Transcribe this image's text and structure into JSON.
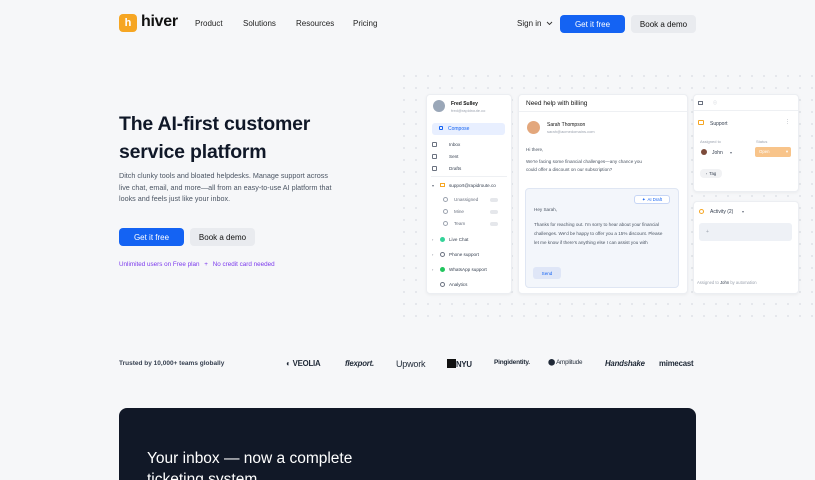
{
  "nav": {
    "logo_letter": "h",
    "brand": "hiver",
    "links": [
      "Product",
      "Solutions",
      "Resources",
      "Pricing"
    ],
    "sign_in": "Sign in",
    "get_it_free": "Get it free",
    "book_demo": "Book a demo"
  },
  "hero": {
    "title": "The AI-first customer service platform",
    "subtitle": "Ditch clunky tools and bloated helpdesks. Manage support across live chat, email, and more—all from an easy-to-use AI platform that looks and feels just like your inbox.",
    "cta_primary": "Get it free",
    "cta_secondary": "Book a demo",
    "note_a": "Unlimited users on Free plan",
    "note_sep": "+",
    "note_b": "No credit card needed"
  },
  "mockup": {
    "user_name": "Fred Sulley",
    "user_email": "fred@rapidroute.co",
    "compose": "Compose",
    "nav": [
      "Inbox",
      "Sent",
      "Drafts"
    ],
    "mailbox": "support@rapidroute.co",
    "sub_items": [
      "Unassigned",
      "Mine",
      "Team"
    ],
    "channels": [
      "Live Chat",
      "Phone support",
      "WhatsApp support",
      "Analytics"
    ],
    "thread_title": "Need help with billing",
    "sender_name": "Sarah Thompson",
    "sender_email": "sarah@acmedomains.com",
    "greeting": "Hi there,",
    "body": "We're facing some financial challenges—any chance you could offer a discount on our subscription?",
    "ai_badge": "AI Draft",
    "draft_greeting": "Hey Sarah,",
    "draft_body": "Thanks for reaching out. I'm sorry to hear about your financial challenges. We'd be happy to offer you a 15% discount. Please let me know if there's anything else I can assist you with",
    "send": "Send",
    "panel_tabs": [
      "",
      ""
    ],
    "panel_support": "Support",
    "assigned_label": "Assigned to",
    "assignee": "John",
    "status_label": "Status",
    "status_value": "Open",
    "tag": "Tag",
    "activity": "Activity (2)",
    "plus": "+",
    "assigned_prefix": "Assigned to",
    "assigned_who": "John",
    "assigned_by": "by automation"
  },
  "trusted": {
    "label": "Trusted by 10,000+ teams globally",
    "brands": [
      "VEOLIA",
      "flexport.",
      "Upwork",
      "NYU",
      "Pingidentity.",
      "Amplitude",
      "Handshake",
      "mimecast"
    ]
  },
  "section": {
    "title": "Your inbox — now a complete ticketing system"
  },
  "colors": {
    "primary": "#1463f3",
    "logo": "#f6a623",
    "dark": "#111827",
    "note": "#7c3aed",
    "status": "#f6a623"
  }
}
